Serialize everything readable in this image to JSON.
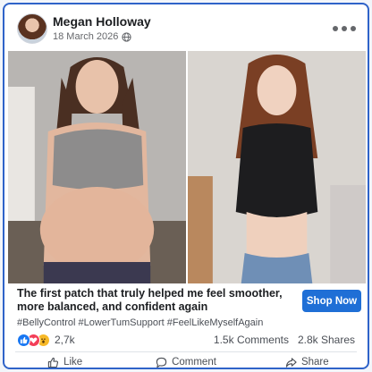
{
  "post": {
    "author": "Megan Holloway",
    "date": "18 March 2026",
    "headline": "The first patch that truly helped me feel smoother, more balanced, and confident again",
    "hashtags": "#BellyControl #LowerTumSupport #FeelLikeMyselfAgain",
    "cta_label": "Shop Now",
    "reactions": {
      "count": "2,7k",
      "types": [
        "like-icon",
        "love-icon",
        "wow-icon"
      ]
    },
    "comments": "1.5k Comments",
    "shares": "2.8k Shares"
  },
  "actions": [
    {
      "label": "Like",
      "icon": "thumbs-up-icon"
    },
    {
      "label": "Comment",
      "icon": "comment-icon"
    },
    {
      "label": "Share",
      "icon": "share-icon"
    }
  ],
  "colors": {
    "accent": "#1f6fd6",
    "frame": "#2f63c9",
    "like": "#1877f2",
    "love": "#f33e58",
    "wow": "#f7b928"
  }
}
